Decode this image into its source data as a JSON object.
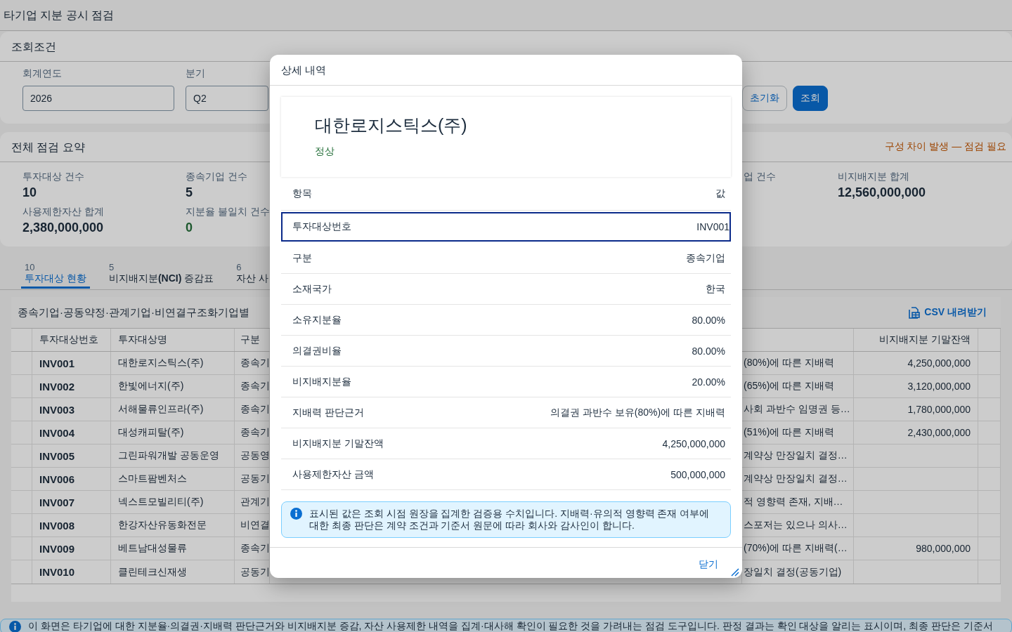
{
  "app_title": "타기업 지분 공시 점검",
  "filter": {
    "title": "조회조건",
    "fields": [
      {
        "label": "회계연도",
        "value": "2026"
      },
      {
        "label": "분기",
        "value": "Q2"
      }
    ],
    "buttons": [
      {
        "label": "초기화",
        "kind": "secondary"
      },
      {
        "label": "조회",
        "kind": "primary"
      }
    ]
  },
  "summary": {
    "title": "전체 점검 요약",
    "status": "구성 차이 발생 — 점검 필요",
    "left_metrics": [
      {
        "label": "투자대상 건수",
        "value": "10",
        "color": "#1d2d3e"
      },
      {
        "label": "종속기업 건수",
        "value": "5",
        "color": "#1d2d3e"
      },
      {
        "label": "사용제한자산 합계",
        "value": "2,380,000,000",
        "color": "#1d2d3e"
      },
      {
        "label": "지분율 불일치 건수",
        "value": "0",
        "color": "#256f3a"
      }
    ],
    "right_metrics": [
      {
        "label": "업 건수"
      },
      {
        "label": "비지배지분 합계",
        "value": "12,560,000,000",
        "color": "#1d2d3e"
      }
    ]
  },
  "tabs": [
    {
      "count": "10",
      "label": "투자대상 현황",
      "selected": true
    },
    {
      "count": "5",
      "label": "비지배지분**(NCI)** 증감표",
      "selected": false
    },
    {
      "count": "6",
      "label": "자산 사",
      "selected": false
    }
  ],
  "table": {
    "title": "종속기업·공동약정·관계기업·비연결구조화기업별",
    "download": "CSV 내려받기",
    "columns": [
      "투자대상번호",
      "투자대상명",
      "구분"
    ],
    "right_column": "비지배지분 기말잔액",
    "rows": [
      {
        "id": "INV001",
        "name": "대한로지스틱스(주)",
        "type": "종속기",
        "column_4": "(80%)에 따른 지배력",
        "balance": "4,250,000,000"
      },
      {
        "id": "INV002",
        "name": "한빛에너지(주)",
        "type": "종속기",
        "column_4": "(65%)에 따른 지배력",
        "balance": "3,120,000,000"
      },
      {
        "id": "INV003",
        "name": "서해물류인프라(주)",
        "type": "종속기",
        "column_4": "사회 과반수 임명권 등…",
        "balance": "1,780,000,000"
      },
      {
        "id": "INV004",
        "name": "대성캐피탈(주)",
        "type": "종속기",
        "column_4": "(51%)에 따른 지배력",
        "balance": "2,430,000,000"
      },
      {
        "id": "INV005",
        "name": "그린파워개발 공동운영",
        "type": "공동영",
        "column_4": "계약상 만장일치 결정…"
      },
      {
        "id": "INV006",
        "name": "스마트팜벤처스",
        "type": "공동기",
        "column_4": "계약상 만장일치 결정…"
      },
      {
        "id": "INV007",
        "name": "넥스트모빌리티(주)",
        "type": "관계기",
        "column_4": "적 영향력 존재, 지배…"
      },
      {
        "id": "INV008",
        "name": "한강자산유동화전문",
        "type": "비연결",
        "column_4": "스포저는 있으나 의사…"
      },
      {
        "id": "INV009",
        "name": "베트남대성물류",
        "type": "종속기",
        "column_4": "(70%)에 따른 지배력(…",
        "balance": "980,000,000"
      },
      {
        "id": "INV010",
        "name": "클린테크신재생",
        "type": "공동기",
        "column_4": "장일치 결정(공동기업)"
      }
    ]
  },
  "footer_note": "이 화면은 타기업에 대한 지분율·의결권·지배력 판단근거와 비지배지분 증감, 자산 사용제한 내역을 집계·대사해 확인이 필요한 것을 가려내는 점검 도구입니다. 판정 결과는 확인 대상을 알리는 표시이며, 최종 판단은 기준서",
  "dialog": {
    "title": "상세 내역",
    "name": "대한로지스틱스(주)",
    "status": "정상",
    "header": [
      "항목",
      "값"
    ],
    "rows": [
      {
        "label": "투자대상번호",
        "value": "INV001",
        "selected": true
      },
      {
        "label": "구분",
        "value": "종속기업",
        "selected": false
      },
      {
        "label": "소재국가",
        "value": "한국",
        "selected": false
      },
      {
        "label": "소유지분율",
        "value": "80.00%",
        "selected": false
      },
      {
        "label": "의결권비율",
        "value": "80.00%",
        "selected": false
      },
      {
        "label": "비지배지분율",
        "value": "20.00%",
        "selected": false
      },
      {
        "label": "지배력 판단근거",
        "value": "의결권 과반수 보유(80%)에 따른 지배력",
        "selected": false
      },
      {
        "label": "비지배지분 기말잔액",
        "value": "4,250,000,000",
        "selected": false
      },
      {
        "label": "사용제한자산 금액",
        "value": "500,000,000",
        "selected": false
      }
    ],
    "note": "표시된 값은 조회 시점 원장을 집계한 검증용 수치입니다. 지배력·유의적 영향력 존재 여부에 대한 최종 판단은 계약 조건과 기준서 원문에 따라 회사와 감사인이 합니다.",
    "close": "닫기"
  }
}
